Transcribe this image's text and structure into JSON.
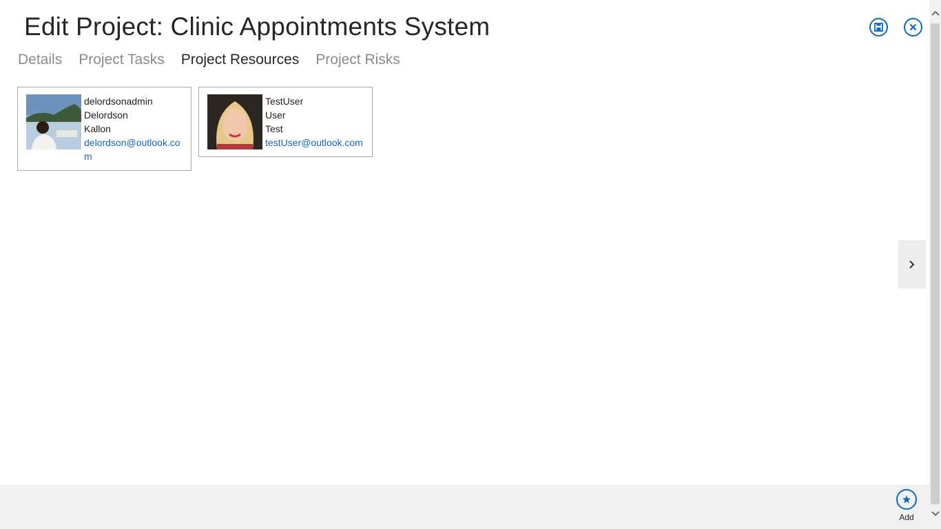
{
  "header": {
    "title": "Edit Project: Clinic Appointments System",
    "save_icon": "save-icon",
    "close_icon": "close-icon"
  },
  "tabs": [
    {
      "label": "Details",
      "active": false
    },
    {
      "label": "Project Tasks",
      "active": false
    },
    {
      "label": "Project Resources",
      "active": true
    },
    {
      "label": "Project Risks",
      "active": false
    }
  ],
  "resources": [
    {
      "username": "delordsonadmin",
      "first_name": "Delordson",
      "last_name": "Kallon",
      "email": "delordson@outlook.com"
    },
    {
      "username": "TestUser",
      "first_name": "User",
      "last_name": "Test",
      "email": "testUser@outlook.com"
    }
  ],
  "appbar": {
    "add_label": "Add",
    "add_icon": "star-icon"
  },
  "colors": {
    "accent": "#1267b8",
    "appbar_bg": "#f0f0f0"
  }
}
